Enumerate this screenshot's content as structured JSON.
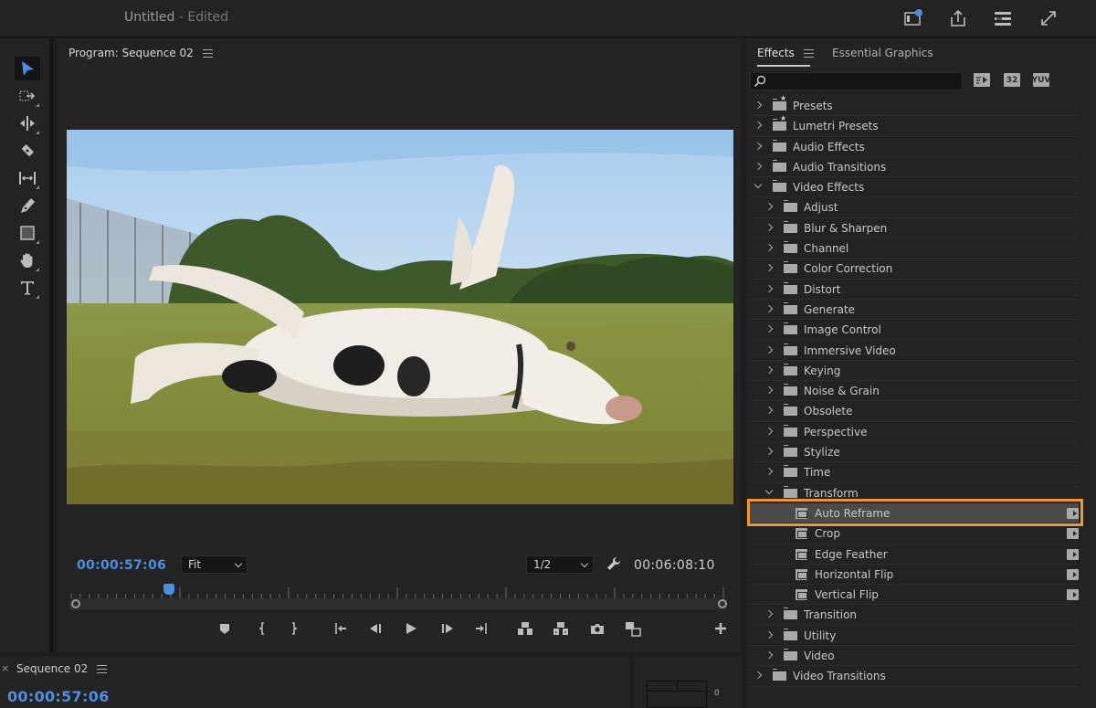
{
  "titlebar": {
    "document_name": "Untitled",
    "status": " - Edited",
    "icons": [
      "quick-export-notification-icon",
      "share-export-icon",
      "workspaces-menu-icon",
      "fullscreen-icon"
    ]
  },
  "tools": [
    {
      "name": "selection-tool",
      "active": true
    },
    {
      "name": "track-select-forward-tool"
    },
    {
      "name": "ripple-edit-tool"
    },
    {
      "name": "razor-tool"
    },
    {
      "name": "slip-tool"
    },
    {
      "name": "pen-tool"
    },
    {
      "name": "rectangle-tool"
    },
    {
      "name": "hand-tool"
    },
    {
      "name": "type-tool"
    }
  ],
  "program_monitor": {
    "title": "Program: Sequence 02",
    "current_timecode": "00:00:57:06",
    "duration_timecode": "00:06:08:10",
    "zoom_select": {
      "value": "Fit"
    },
    "resolution_select": {
      "value": "1/2"
    },
    "playhead_position_fraction": 0.152,
    "transport_buttons": [
      "add-marker",
      "mark-in",
      "mark-out",
      "go-to-in",
      "step-back",
      "play",
      "step-forward",
      "go-to-out",
      "lift",
      "extract",
      "export-frame",
      "comparison-view",
      "button-editor"
    ]
  },
  "timeline": {
    "close_label": "×",
    "title": "Sequence 02",
    "timecode": "00:00:57:06"
  },
  "audio_meter": {
    "zero_label": "0"
  },
  "effects_panel": {
    "tabs": [
      {
        "label": "Effects",
        "active": true
      },
      {
        "label": "Essential Graphics",
        "active": false
      }
    ],
    "search": {
      "value": "",
      "placeholder": ""
    },
    "filter_badges": [
      "",
      "32",
      "YUV"
    ],
    "tree": [
      {
        "label": "Presets",
        "level": 0,
        "type": "preset-folder",
        "expanded": false
      },
      {
        "label": "Lumetri Presets",
        "level": 0,
        "type": "preset-folder",
        "expanded": false
      },
      {
        "label": "Audio Effects",
        "level": 0,
        "type": "folder",
        "expanded": false
      },
      {
        "label": "Audio Transitions",
        "level": 0,
        "type": "folder",
        "expanded": false
      },
      {
        "label": "Video Effects",
        "level": 0,
        "type": "folder",
        "expanded": true
      },
      {
        "label": "Adjust",
        "level": 1,
        "type": "folder",
        "expanded": false
      },
      {
        "label": "Blur & Sharpen",
        "level": 1,
        "type": "folder",
        "expanded": false
      },
      {
        "label": "Channel",
        "level": 1,
        "type": "folder",
        "expanded": false
      },
      {
        "label": "Color Correction",
        "level": 1,
        "type": "folder",
        "expanded": false
      },
      {
        "label": "Distort",
        "level": 1,
        "type": "folder",
        "expanded": false
      },
      {
        "label": "Generate",
        "level": 1,
        "type": "folder",
        "expanded": false
      },
      {
        "label": "Image Control",
        "level": 1,
        "type": "folder",
        "expanded": false
      },
      {
        "label": "Immersive Video",
        "level": 1,
        "type": "folder",
        "expanded": false
      },
      {
        "label": "Keying",
        "level": 1,
        "type": "folder",
        "expanded": false
      },
      {
        "label": "Noise & Grain",
        "level": 1,
        "type": "folder",
        "expanded": false
      },
      {
        "label": "Obsolete",
        "level": 1,
        "type": "folder",
        "expanded": false
      },
      {
        "label": "Perspective",
        "level": 1,
        "type": "folder",
        "expanded": false
      },
      {
        "label": "Stylize",
        "level": 1,
        "type": "folder",
        "expanded": false
      },
      {
        "label": "Time",
        "level": 1,
        "type": "folder",
        "expanded": false
      },
      {
        "label": "Transform",
        "level": 1,
        "type": "folder",
        "expanded": true
      },
      {
        "label": "Auto Reframe",
        "level": 2,
        "type": "effect",
        "accelerated": true,
        "selected": true
      },
      {
        "label": "Crop",
        "level": 2,
        "type": "effect",
        "accelerated": true
      },
      {
        "label": "Edge Feather",
        "level": 2,
        "type": "effect",
        "accelerated": true
      },
      {
        "label": "Horizontal Flip",
        "level": 2,
        "type": "effect",
        "accelerated": true
      },
      {
        "label": "Vertical Flip",
        "level": 2,
        "type": "effect",
        "accelerated": true
      },
      {
        "label": "Transition",
        "level": 1,
        "type": "folder",
        "expanded": false
      },
      {
        "label": "Utility",
        "level": 1,
        "type": "folder",
        "expanded": false
      },
      {
        "label": "Video",
        "level": 1,
        "type": "folder",
        "expanded": false
      },
      {
        "label": "Video Transitions",
        "level": 0,
        "type": "folder",
        "expanded": false
      }
    ]
  },
  "colors": {
    "accent_blue": "#4b8fe0",
    "highlight_orange": "#f0972a",
    "panel_bg": "#232323"
  }
}
